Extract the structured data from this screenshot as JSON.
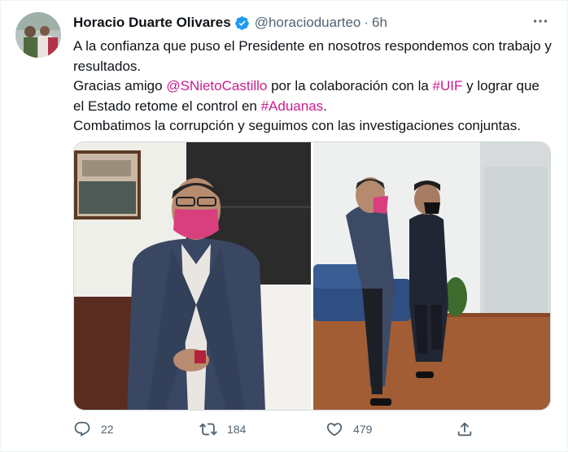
{
  "tweet": {
    "author_name": "Horacio Duarte Olivares",
    "handle": "@horacioduarteo",
    "separator": "·",
    "time": "6h",
    "more_icon": "more-horizontal-icon",
    "text_line1": "A la confianza que puso el Presidente en nosotros respondemos con trabajo y resultados.",
    "text_line2_before": "Gracias amigo ",
    "mention": "@SNietoCastillo",
    "text_line2_mid": " por la colaboración con la ",
    "hashtag_uif": "#UIF",
    "text_line2_after": " y lograr que el Estado retome el control en ",
    "hashtag_aduanas": "#Aduanas",
    "text_line2_end": ".",
    "text_line3": "Combatimos la corrupción y seguimos con las investigaciones conjuntas."
  },
  "actions": {
    "reply_count": "22",
    "retweet_count": "184",
    "like_count": "479"
  },
  "colors": {
    "link": "#c91d8d",
    "verified": "#1d9bf0",
    "secondary_text": "#536471"
  }
}
